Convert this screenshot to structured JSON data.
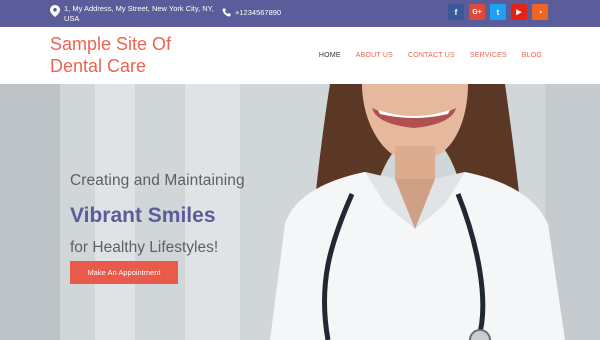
{
  "topbar": {
    "address": "1, My Address, My Street, New York City, NY, USA",
    "phone": "+1234567890",
    "socials": [
      {
        "name": "facebook",
        "glyph": "f",
        "color": "#3b5998"
      },
      {
        "name": "google-plus",
        "glyph": "G+",
        "color": "#dd4b39"
      },
      {
        "name": "twitter",
        "glyph": "t",
        "color": "#1da1f2"
      },
      {
        "name": "youtube",
        "glyph": "▶",
        "color": "#e62117"
      },
      {
        "name": "rss",
        "glyph": "◔",
        "color": "#f26522"
      }
    ]
  },
  "header": {
    "site_title": "Sample Site Of Dental Care",
    "nav": [
      "HOME",
      "ABOUT US",
      "CONTACT US",
      "SERVICES",
      "BLOG"
    ]
  },
  "hero": {
    "line1": "Creating and Maintaining",
    "line2": "Vibrant Smiles",
    "line3": "for Healthy Lifestyles!",
    "cta": "Make An Appointment"
  },
  "colors": {
    "topbar": "#5b5d9a",
    "accent": "#e96551",
    "button": "#e95a4a"
  }
}
